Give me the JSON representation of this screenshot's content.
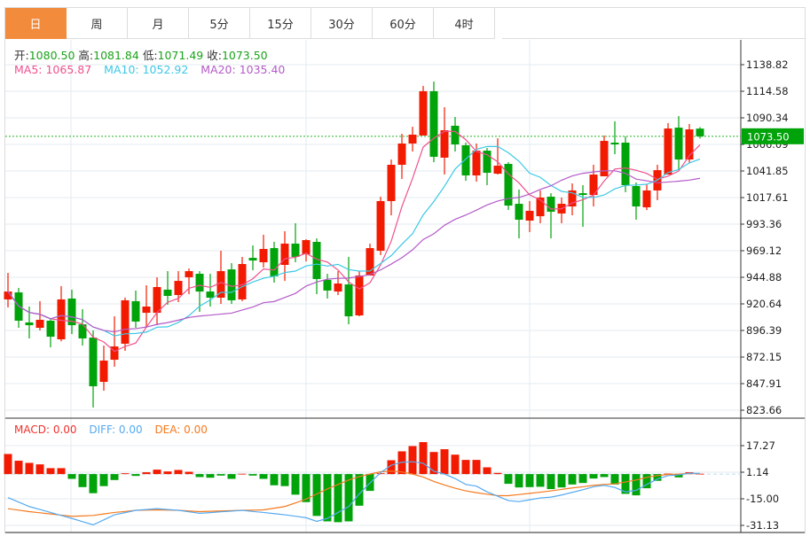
{
  "tabs": [
    {
      "label": "日",
      "active": true
    },
    {
      "label": "周",
      "active": false
    },
    {
      "label": "月",
      "active": false
    },
    {
      "label": "5分",
      "active": false
    },
    {
      "label": "15分",
      "active": false
    },
    {
      "label": "30分",
      "active": false
    },
    {
      "label": "60分",
      "active": false
    },
    {
      "label": "4时",
      "active": false
    }
  ],
  "ohlc_info": {
    "open_label": "开:",
    "open": "1080.50",
    "high_label": "高:",
    "high": "1081.84",
    "low_label": "低:",
    "low": "1071.49",
    "close_label": "收:",
    "close": "1073.50"
  },
  "ma_info": {
    "ma5": "MA5: 1065.87",
    "ma10": "MA10: 1052.92",
    "ma20": "MA20: 1035.40"
  },
  "macd_info": {
    "macd": "MACD: 0.00",
    "diff": "DIFF: 0.00",
    "dea": "DEA: 0.00"
  },
  "colors": {
    "up": "#f21a00",
    "down": "#00a30a",
    "ma5": "#f0508c",
    "ma10": "#3cc8e6",
    "ma20": "#b45ac8",
    "diff": "#55aaf0",
    "dea": "#f57a1e",
    "accent": "#f28b3c",
    "price_tag": "#00a30a"
  },
  "chart_data": [
    {
      "type": "candlestick",
      "y_ticks": [
        "1138.82",
        "1114.58",
        "1090.34",
        "1066.09",
        "1041.85",
        "1017.61",
        "993.36",
        "969.12",
        "944.88",
        "920.64",
        "896.39",
        "872.15",
        "847.91",
        "823.66"
      ],
      "ylim": [
        823.66,
        1138.82
      ],
      "last_price": "1073.50",
      "ohlc": [
        [
          924.7,
          948.9,
          917.4,
          931.9
        ],
        [
          931.1,
          935.2,
          898.8,
          905.3
        ],
        [
          903.7,
          918.2,
          889.1,
          901.2
        ],
        [
          898.8,
          923.1,
          896.4,
          906.1
        ],
        [
          905.3,
          907.7,
          881.0,
          890.7
        ],
        [
          888.3,
          936.8,
          886.5,
          924.7
        ],
        [
          925.5,
          933.6,
          893.1,
          901.2
        ],
        [
          902.0,
          915.8,
          882.6,
          889.1
        ],
        [
          889.9,
          896.4,
          826.1,
          845.5
        ],
        [
          849.5,
          882.6,
          841.4,
          868.9
        ],
        [
          869.7,
          909.3,
          863.3,
          881.8
        ],
        [
          884.3,
          926.3,
          877.8,
          923.9
        ],
        [
          923.1,
          932.8,
          898.8,
          904.5
        ],
        [
          912.5,
          937.6,
          898.8,
          918.2
        ],
        [
          912.5,
          944.9,
          901.2,
          936.0
        ],
        [
          933.6,
          950.5,
          919.8,
          927.9
        ],
        [
          928.7,
          950.5,
          922.3,
          941.6
        ],
        [
          944.9,
          952.9,
          929.5,
          950.5
        ],
        [
          948.1,
          950.5,
          913.4,
          931.9
        ],
        [
          931.9,
          948.1,
          918.2,
          926.3
        ],
        [
          926.3,
          969.1,
          920.6,
          950.5
        ],
        [
          952.1,
          957.8,
          920.6,
          923.9
        ],
        [
          924.7,
          963.5,
          923.1,
          957.0
        ],
        [
          962.6,
          973.9,
          951.3,
          960.2
        ],
        [
          958.6,
          983.7,
          953.8,
          970.7
        ],
        [
          971.5,
          977.2,
          940.0,
          945.7
        ],
        [
          956.2,
          986.9,
          941.6,
          975.6
        ],
        [
          975.6,
          994.2,
          958.6,
          963.5
        ],
        [
          965.9,
          979.6,
          959.4,
          978.8
        ],
        [
          977.2,
          980.4,
          929.5,
          943.3
        ],
        [
          942.5,
          948.1,
          925.5,
          932.8
        ],
        [
          931.9,
          950.5,
          928.7,
          939.2
        ],
        [
          938.4,
          963.5,
          902.0,
          909.3
        ],
        [
          910.1,
          950.5,
          909.3,
          946.5
        ],
        [
          946.5,
          975.6,
          946.5,
          971.5
        ],
        [
          969.1,
          1018.4,
          965.1,
          1014.4
        ],
        [
          1014.4,
          1052.3,
          1001.4,
          1047.5
        ],
        [
          1047.5,
          1075.8,
          1034.6,
          1066.9
        ],
        [
          1066.9,
          1082.2,
          1059.6,
          1075.0
        ],
        [
          1074.2,
          1119.4,
          1074.2,
          1114.6
        ],
        [
          1114.6,
          1123.4,
          1049.9,
          1054.8
        ],
        [
          1054.0,
          1100.0,
          1038.6,
          1079.0
        ],
        [
          1083.1,
          1091.1,
          1059.6,
          1066.1
        ],
        [
          1065.3,
          1067.7,
          1032.9,
          1037.8
        ],
        [
          1037.8,
          1066.9,
          1032.1,
          1060.4
        ],
        [
          1060.4,
          1062.8,
          1028.9,
          1040.2
        ],
        [
          1039.4,
          1071.7,
          1038.6,
          1046.7
        ],
        [
          1048.3,
          1049.9,
          1006.3,
          1010.3
        ],
        [
          1011.9,
          1024.9,
          980.4,
          997.4
        ],
        [
          996.6,
          1014.4,
          986.1,
          1005.5
        ],
        [
          1000.6,
          1024.1,
          994.2,
          1017.6
        ],
        [
          1018.4,
          1021.6,
          980.4,
          1004.7
        ],
        [
          1003.1,
          1017.6,
          994.2,
          1011.9
        ],
        [
          1009.5,
          1030.5,
          1001.4,
          1024.1
        ],
        [
          1021.6,
          1028.9,
          990.9,
          1020.0
        ],
        [
          1020.0,
          1047.5,
          1009.5,
          1038.6
        ],
        [
          1037.0,
          1074.2,
          1037.0,
          1069.3
        ],
        [
          1067.7,
          1087.1,
          1057.2,
          1066.1
        ],
        [
          1067.7,
          1073.4,
          1022.5,
          1028.9
        ],
        [
          1028.1,
          1031.3,
          997.4,
          1009.5
        ],
        [
          1008.7,
          1029.7,
          1006.3,
          1024.1
        ],
        [
          1024.1,
          1047.5,
          1015.2,
          1042.6
        ],
        [
          1038.6,
          1085.5,
          1038.6,
          1080.6
        ],
        [
          1081.4,
          1091.9,
          1042.6,
          1052.3
        ],
        [
          1052.3,
          1084.7,
          1049.1,
          1079.8
        ],
        [
          1080.5,
          1081.84,
          1071.49,
          1073.5
        ]
      ],
      "moving_averages": [
        "MA5",
        "MA10",
        "MA20"
      ],
      "grid": true
    },
    {
      "type": "bar+line",
      "y_ticks": [
        "17.27",
        "1.14",
        "-15.00",
        "-31.13"
      ],
      "ylim": [
        -31.13,
        17.27
      ],
      "macd_hist": [
        12.2,
        8.1,
        6.8,
        5.9,
        3.6,
        3.6,
        -2.9,
        -7.9,
        -11.6,
        -7.3,
        -3.6,
        0.5,
        -1.1,
        1.1,
        2.7,
        1.6,
        2.5,
        1.4,
        -1.8,
        -2.2,
        -0.9,
        -2.9,
        0.2,
        -0.9,
        -2.9,
        -6.8,
        -7.3,
        -12.5,
        -17.0,
        -25.4,
        -28.7,
        -29.2,
        -28.7,
        -19.2,
        -10.2,
        0.5,
        8.4,
        13.8,
        17.0,
        19.4,
        13.4,
        15.1,
        11.8,
        8.6,
        8.6,
        4.1,
        0.7,
        -5.9,
        -8.1,
        -7.9,
        -7.7,
        -9.1,
        -8.1,
        -6.3,
        -5.4,
        -2.7,
        -1.8,
        -6.3,
        -12.0,
        -12.9,
        -8.6,
        -4.1,
        0.3,
        -2.0,
        1.1,
        0.2
      ],
      "diff": [
        -14.3,
        -17.0,
        -19.7,
        -21.5,
        -23.3,
        -25.1,
        -26.9,
        -28.9,
        -30.8,
        -27.8,
        -24.7,
        -23.4,
        -22.0,
        -21.5,
        -21.0,
        -21.5,
        -22.0,
        -22.9,
        -23.8,
        -23.4,
        -22.9,
        -22.5,
        -22.0,
        -22.7,
        -23.3,
        -24.0,
        -24.7,
        -25.6,
        -26.5,
        -28.7,
        -26.9,
        -23.3,
        -19.7,
        -12.0,
        -5.4,
        0.9,
        5.4,
        7.2,
        7.5,
        6.6,
        1.8,
        0,
        -2.7,
        -6.3,
        -7.3,
        -10.8,
        -13.4,
        -16.1,
        -16.7,
        -15.6,
        -14.5,
        -14.0,
        -12.7,
        -11.1,
        -9.5,
        -7.7,
        -6.8,
        -8.1,
        -10.8,
        -9.9,
        -6.3,
        -3.0,
        -0.9,
        -0.5,
        0.5,
        0.4
      ],
      "dea": [
        -21.0,
        -21.9,
        -22.8,
        -23.5,
        -24.2,
        -24.9,
        -25.6,
        -25.4,
        -25.1,
        -24.2,
        -23.3,
        -22.7,
        -22.0,
        -21.9,
        -21.7,
        -21.9,
        -22.0,
        -22.4,
        -22.8,
        -22.6,
        -22.4,
        -22.2,
        -22.0,
        -21.9,
        -21.7,
        -20.7,
        -19.7,
        -17.5,
        -15.2,
        -12.1,
        -9.0,
        -6.3,
        -3.6,
        -1.5,
        0,
        1.4,
        1.8,
        1.3,
        0,
        -1.8,
        -4.5,
        -6.6,
        -8.6,
        -10.2,
        -11.3,
        -12.2,
        -13.1,
        -13.1,
        -12.4,
        -11.7,
        -11.0,
        -10.2,
        -9.3,
        -8.4,
        -7.7,
        -6.8,
        -6.3,
        -5.9,
        -4.8,
        -3.6,
        -2.0,
        -0.9,
        -0.2,
        0,
        0.4,
        0.2
      ]
    }
  ]
}
